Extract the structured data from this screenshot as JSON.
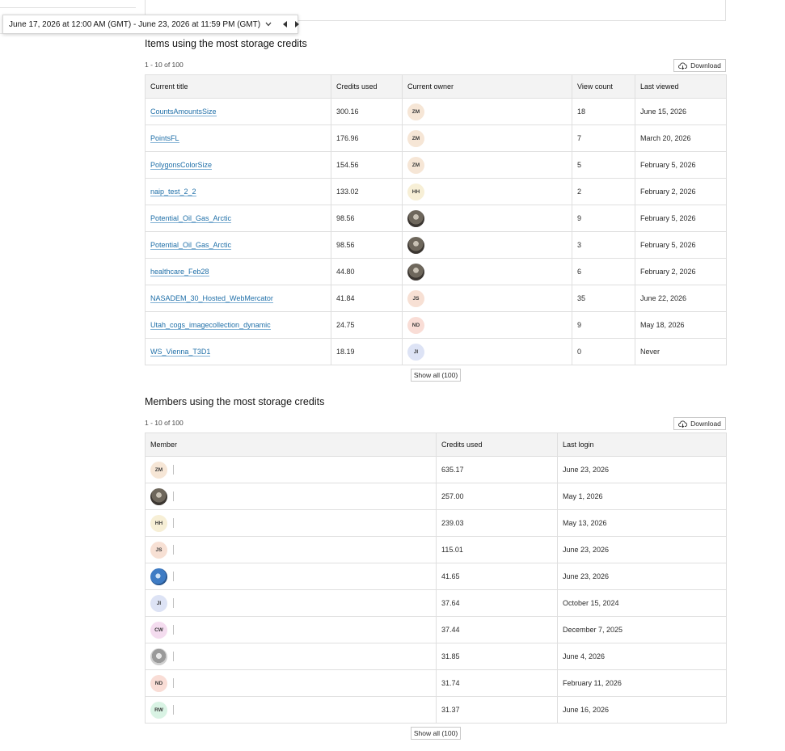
{
  "date_range": {
    "label": "June 17, 2026 at 12:00 AM (GMT) - June 23, 2026 at 11:59 PM (GMT)"
  },
  "items_section": {
    "title": "Items using the most storage credits",
    "range": "1 - 10 of 100",
    "download_label": "Download",
    "show_all_label": "Show all (100)",
    "columns": [
      "Current title",
      "Credits used",
      "Current owner",
      "View count",
      "Last viewed"
    ],
    "rows": [
      {
        "title": "CountsAmountsSize",
        "credits": "300.16",
        "owner": "ZM",
        "owner_style": "initials",
        "owner_bg": "#f6e6d6",
        "views": "18",
        "last_viewed": "June 15, 2026"
      },
      {
        "title": "PointsFL",
        "credits": "176.96",
        "owner": "ZM",
        "owner_style": "initials",
        "owner_bg": "#f6e6d6",
        "views": "7",
        "last_viewed": "March 20, 2026"
      },
      {
        "title": "PolygonsColorSize",
        "credits": "154.56",
        "owner": "ZM",
        "owner_style": "initials",
        "owner_bg": "#f6e6d6",
        "views": "5",
        "last_viewed": "February 5, 2026"
      },
      {
        "title": "naip_test_2_2",
        "credits": "133.02",
        "owner": "HH",
        "owner_style": "initials",
        "owner_bg": "#f7efd6",
        "views": "2",
        "last_viewed": "February 2, 2026"
      },
      {
        "title": "Potential_Oil_Gas_Arctic",
        "credits": "98.56",
        "owner": "",
        "owner_style": "img-dark",
        "owner_bg": "",
        "views": "9",
        "last_viewed": "February 5, 2026"
      },
      {
        "title": "Potential_Oil_Gas_Arctic",
        "credits": "98.56",
        "owner": "",
        "owner_style": "img-dark",
        "owner_bg": "",
        "views": "3",
        "last_viewed": "February 5, 2026"
      },
      {
        "title": "healthcare_Feb28",
        "credits": "44.80",
        "owner": "",
        "owner_style": "img-dark",
        "owner_bg": "",
        "views": "6",
        "last_viewed": "February 2, 2026"
      },
      {
        "title": "NASADEM_30_Hosted_WebMercator",
        "credits": "41.84",
        "owner": "JS",
        "owner_style": "initials",
        "owner_bg": "#f7e0d4",
        "views": "35",
        "last_viewed": "June 22, 2026"
      },
      {
        "title": "Utah_cogs_imagecollection_dynamic",
        "credits": "24.75",
        "owner": "ND",
        "owner_style": "initials",
        "owner_bg": "#f9ddd6",
        "views": "9",
        "last_viewed": "May 18, 2026"
      },
      {
        "title": "WS_Vienna_T3D1",
        "credits": "18.19",
        "owner": "JI",
        "owner_style": "initials",
        "owner_bg": "#dde3f5",
        "views": "0",
        "last_viewed": "Never"
      }
    ]
  },
  "members_section": {
    "title": "Members using the most storage credits",
    "range": "1 - 10 of 100",
    "download_label": "Download",
    "show_all_label": "Show all (100)",
    "columns": [
      "Member",
      "Credits used",
      "Last login"
    ],
    "rows": [
      {
        "initials": "ZM",
        "avatar_style": "initials",
        "avatar_bg": "#f6e6d6",
        "credits": "635.17",
        "last_login": "June 23, 2026"
      },
      {
        "initials": "",
        "avatar_style": "img-dark",
        "avatar_bg": "",
        "credits": "257.00",
        "last_login": "May 1, 2026"
      },
      {
        "initials": "HH",
        "avatar_style": "initials",
        "avatar_bg": "#f7efd6",
        "credits": "239.03",
        "last_login": "May 13, 2026"
      },
      {
        "initials": "JS",
        "avatar_style": "initials",
        "avatar_bg": "#f7e0d4",
        "credits": "115.01",
        "last_login": "June 23, 2026"
      },
      {
        "initials": "",
        "avatar_style": "img-globe",
        "avatar_bg": "",
        "credits": "41.65",
        "last_login": "June 23, 2026"
      },
      {
        "initials": "JI",
        "avatar_style": "initials",
        "avatar_bg": "#dde3f5",
        "credits": "37.64",
        "last_login": "October 15, 2024"
      },
      {
        "initials": "CW",
        "avatar_style": "initials",
        "avatar_bg": "#f4dcef",
        "credits": "37.44",
        "last_login": "December 7, 2025"
      },
      {
        "initials": "",
        "avatar_style": "img-photo",
        "avatar_bg": "",
        "credits": "31.85",
        "last_login": "June 4, 2026"
      },
      {
        "initials": "ND",
        "avatar_style": "initials",
        "avatar_bg": "#f9ddd6",
        "credits": "31.74",
        "last_login": "February 11, 2026"
      },
      {
        "initials": "RW",
        "avatar_style": "initials",
        "avatar_bg": "#d9f3e4",
        "credits": "31.37",
        "last_login": "June 16, 2026"
      }
    ]
  }
}
